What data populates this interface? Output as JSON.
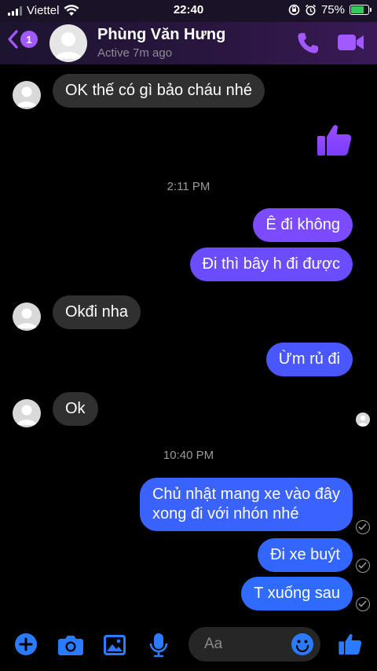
{
  "status_bar": {
    "carrier": "Viettel",
    "time": "22:40",
    "battery": "75%",
    "battery_level": 0.75
  },
  "header": {
    "back_badge": "1",
    "contact_name": "Phùng Văn Hưng",
    "contact_status": "Active 7m ago",
    "icons": [
      "back-chevron-icon",
      "phone-icon",
      "video-camera-icon"
    ]
  },
  "messages": {
    "m1": "OK thế có gì bảo cháu nhé",
    "time1": "2:11 PM",
    "m2": "Ê đi không",
    "m3": "Đi thì bây h đi được",
    "m4": "Okđi nha",
    "m5": "Ừm rủ đi",
    "m6": "Ok",
    "time2": "10:40 PM",
    "m7_line1": "Chủ nhật mang xe vào đây",
    "m7_line2": "xong đi với nhón nhé",
    "m8": "Đi xe buýt",
    "m9": "T xuống sau"
  },
  "composer": {
    "placeholder": "Aa",
    "icons": [
      "plus-icon",
      "camera-icon",
      "image-icon",
      "microphone-icon",
      "emoji-icon",
      "thumbs-up-icon"
    ]
  },
  "colors": {
    "accent": "#a259ff",
    "outgoing_top": "#8a4bff",
    "outgoing_bottom": "#2f6bff",
    "incoming": "#303030"
  }
}
